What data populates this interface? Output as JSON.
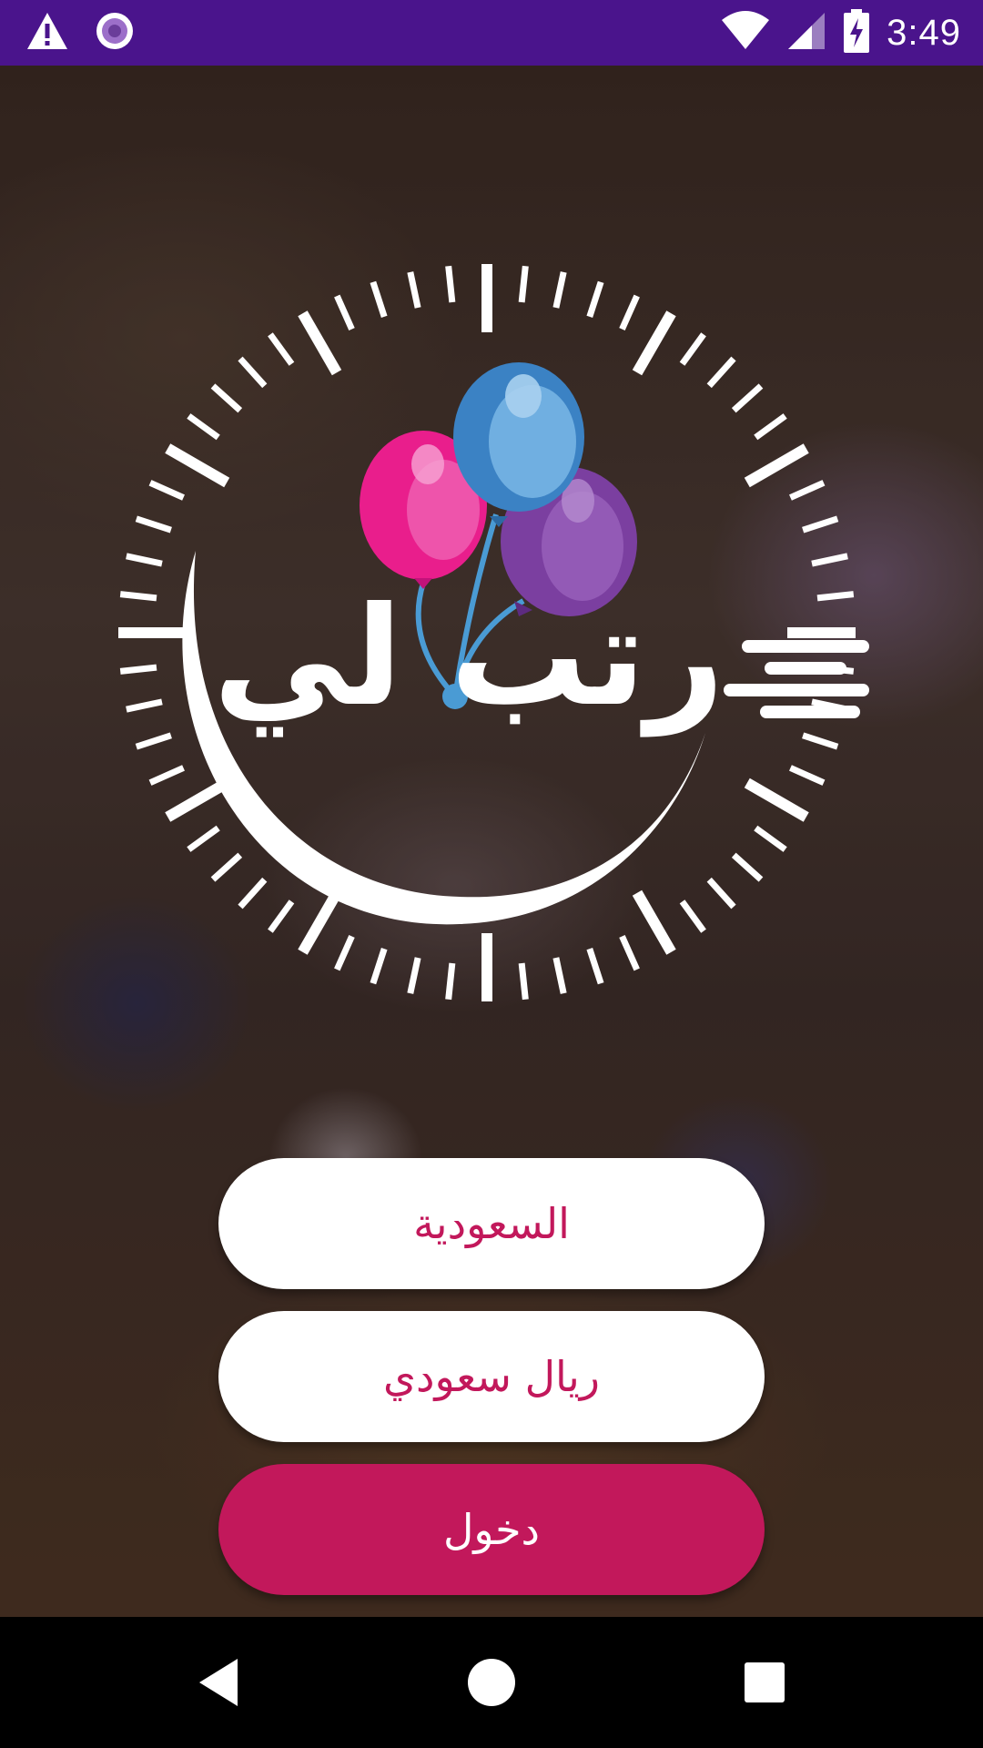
{
  "status_bar": {
    "time": "3:49",
    "icons": [
      "warning-icon",
      "location-icon",
      "wifi-icon",
      "signal-icon",
      "battery-charging-icon"
    ]
  },
  "logo": {
    "icon": "balloons-clock-logo",
    "brand_text": "رتب لي",
    "colors": {
      "balloon_pink": "#e91e8c",
      "balloon_blue": "#4a90c8",
      "balloon_purple": "#7b3fa0",
      "string": "#4a9bd4"
    }
  },
  "form": {
    "country_label": "السعودية",
    "currency_label": "ريال سعودي",
    "login_label": "دخول"
  },
  "nav_bar": {
    "icons": [
      "back-icon",
      "home-icon",
      "recents-icon"
    ]
  },
  "colors": {
    "status_bar": "#4a148c",
    "accent": "#c2185b",
    "button_bg": "#ffffff"
  }
}
